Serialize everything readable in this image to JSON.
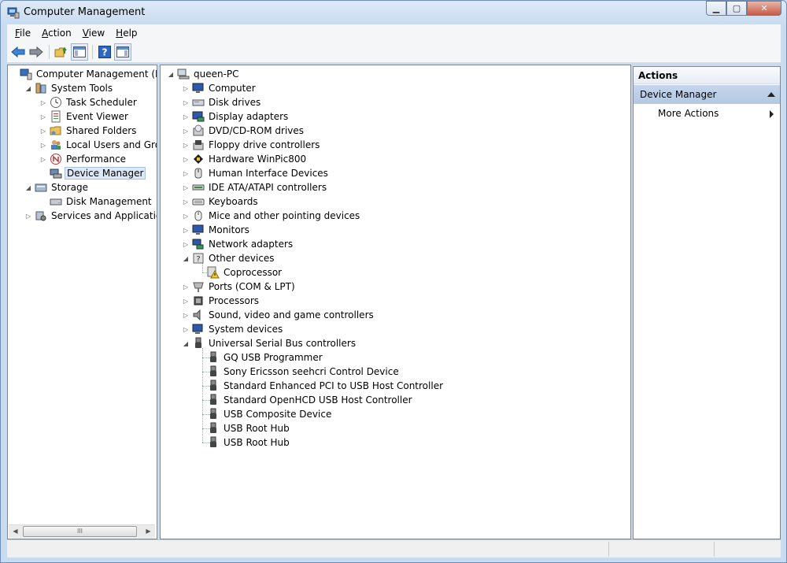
{
  "window": {
    "title": "Computer Management"
  },
  "menu": [
    {
      "key": "F",
      "rest": "ile"
    },
    {
      "key": "A",
      "rest": "ction"
    },
    {
      "key": "V",
      "rest": "iew"
    },
    {
      "key": "H",
      "rest": "elp"
    }
  ],
  "left_tree": [
    {
      "label": "Computer Management (Local",
      "level": 0,
      "expander": "",
      "icon": "computer-management-icon"
    },
    {
      "label": "System Tools",
      "level": 1,
      "expander": "◢",
      "icon": "system-tools-icon"
    },
    {
      "label": "Task Scheduler",
      "level": 2,
      "expander": "▷",
      "icon": "clock-icon"
    },
    {
      "label": "Event Viewer",
      "level": 2,
      "expander": "▷",
      "icon": "event-viewer-icon"
    },
    {
      "label": "Shared Folders",
      "level": 2,
      "expander": "▷",
      "icon": "shared-folder-icon"
    },
    {
      "label": "Local Users and Groups",
      "level": 2,
      "expander": "▷",
      "icon": "users-icon"
    },
    {
      "label": "Performance",
      "level": 2,
      "expander": "▷",
      "icon": "performance-icon"
    },
    {
      "label": "Device Manager",
      "level": 2,
      "expander": "",
      "icon": "device-manager-icon",
      "selected": true
    },
    {
      "label": "Storage",
      "level": 1,
      "expander": "◢",
      "icon": "storage-icon"
    },
    {
      "label": "Disk Management",
      "level": 2,
      "expander": "",
      "icon": "disk-icon"
    },
    {
      "label": "Services and Applications",
      "level": 1,
      "expander": "▷",
      "icon": "services-icon"
    }
  ],
  "device_tree": [
    {
      "label": "queen-PC",
      "level": 0,
      "expander": "◢",
      "icon": "computer-icon"
    },
    {
      "label": "Computer",
      "level": 1,
      "expander": "▷",
      "icon": "monitor-icon"
    },
    {
      "label": "Disk drives",
      "level": 1,
      "expander": "▷",
      "icon": "disk-drive-icon"
    },
    {
      "label": "Display adapters",
      "level": 1,
      "expander": "▷",
      "icon": "display-adapter-icon"
    },
    {
      "label": "DVD/CD-ROM drives",
      "level": 1,
      "expander": "▷",
      "icon": "dvd-icon"
    },
    {
      "label": "Floppy drive controllers",
      "level": 1,
      "expander": "▷",
      "icon": "floppy-icon"
    },
    {
      "label": "Hardware WinPic800",
      "level": 1,
      "expander": "▷",
      "icon": "chip-programmer-icon"
    },
    {
      "label": "Human Interface Devices",
      "level": 1,
      "expander": "▷",
      "icon": "hid-icon"
    },
    {
      "label": "IDE ATA/ATAPI controllers",
      "level": 1,
      "expander": "▷",
      "icon": "ide-controller-icon"
    },
    {
      "label": "Keyboards",
      "level": 1,
      "expander": "▷",
      "icon": "keyboard-icon"
    },
    {
      "label": "Mice and other pointing devices",
      "level": 1,
      "expander": "▷",
      "icon": "mouse-icon"
    },
    {
      "label": "Monitors",
      "level": 1,
      "expander": "▷",
      "icon": "monitor-icon"
    },
    {
      "label": "Network adapters",
      "level": 1,
      "expander": "▷",
      "icon": "network-icon"
    },
    {
      "label": "Other devices",
      "level": 1,
      "expander": "◢",
      "icon": "unknown-device-icon"
    },
    {
      "label": "Coprocessor",
      "level": 2,
      "expander": "",
      "icon": "warning-device-icon"
    },
    {
      "label": "Ports (COM & LPT)",
      "level": 1,
      "expander": "▷",
      "icon": "port-icon"
    },
    {
      "label": "Processors",
      "level": 1,
      "expander": "▷",
      "icon": "processor-icon"
    },
    {
      "label": "Sound, video and game controllers",
      "level": 1,
      "expander": "▷",
      "icon": "speaker-icon"
    },
    {
      "label": "System devices",
      "level": 1,
      "expander": "▷",
      "icon": "system-device-icon"
    },
    {
      "label": "Universal Serial Bus controllers",
      "level": 1,
      "expander": "◢",
      "icon": "usb-icon"
    },
    {
      "label": "GQ USB Programmer",
      "level": 2,
      "expander": "",
      "icon": "usb-icon"
    },
    {
      "label": "Sony Ericsson seehcri Control Device",
      "level": 2,
      "expander": "",
      "icon": "usb-icon"
    },
    {
      "label": "Standard Enhanced PCI to USB Host Controller",
      "level": 2,
      "expander": "",
      "icon": "usb-icon"
    },
    {
      "label": "Standard OpenHCD USB Host Controller",
      "level": 2,
      "expander": "",
      "icon": "usb-icon"
    },
    {
      "label": "USB Composite Device",
      "level": 2,
      "expander": "",
      "icon": "usb-icon"
    },
    {
      "label": "USB Root Hub",
      "level": 2,
      "expander": "",
      "icon": "usb-icon"
    },
    {
      "label": "USB Root Hub",
      "level": 2,
      "expander": "",
      "icon": "usb-icon"
    }
  ],
  "actions": {
    "header": "Actions",
    "section": "Device Manager",
    "items": [
      "More Actions"
    ]
  },
  "scrollbar_grip": "III"
}
